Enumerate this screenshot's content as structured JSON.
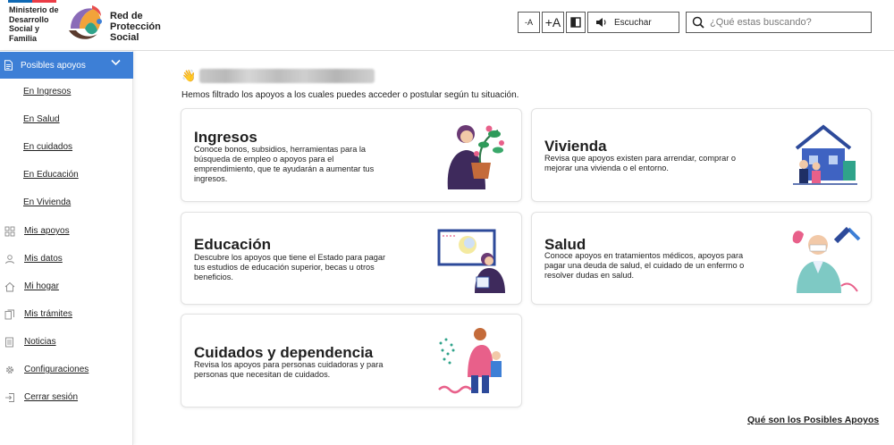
{
  "header": {
    "ministry_lines": [
      "Ministerio de",
      "Desarrollo",
      "Social y",
      "Familia"
    ],
    "network_lines": [
      "Red de",
      "Protección",
      "Social"
    ],
    "accessibility": {
      "decrease_text": "-A",
      "increase_text": "+A",
      "contrast_icon": "contrast-icon",
      "listen_label": "Escuchar"
    },
    "search": {
      "placeholder": "¿Qué estas buscando?",
      "value": ""
    }
  },
  "sidebar": {
    "active": {
      "label": "Posibles apoyos",
      "icon": "document-icon"
    },
    "sub_items": [
      "En Ingresos",
      "En Salud",
      "En cuidados",
      "En Educación",
      "En Vivienda"
    ],
    "items": [
      {
        "label": "Mis apoyos",
        "icon": "grid-icon"
      },
      {
        "label": "Mis datos",
        "icon": "user-icon"
      },
      {
        "label": "Mi hogar",
        "icon": "home-icon"
      },
      {
        "label": "Mis trámites",
        "icon": "files-icon"
      },
      {
        "label": "Noticias",
        "icon": "news-icon"
      },
      {
        "label": "Configuraciones",
        "icon": "gear-icon"
      },
      {
        "label": "Cerrar sesión",
        "icon": "logout-icon"
      }
    ]
  },
  "main": {
    "greeting_emoji": "👋",
    "intro": "Hemos filtrado los apoyos a los cuales puedes acceder o postular según tu situación.",
    "cards": {
      "ingresos": {
        "title": "Ingresos",
        "description": "Conoce bonos, subsidios, herramientas para la búsqueda de empleo o apoyos para el emprendimiento, que te ayudarán a aumentar tus ingresos."
      },
      "vivienda": {
        "title": "Vivienda",
        "description": "Revisa que apoyos existen para arrendar, comprar o mejorar una vivienda o el entorno."
      },
      "educacion": {
        "title": "Educación",
        "description": "Descubre los apoyos que tiene el Estado para pagar tus estudios de educación superior, becas u otros beneficios."
      },
      "salud": {
        "title": "Salud",
        "description": "Conoce apoyos en tratamientos médicos, apoyos para pagar una deuda de salud, el cuidado de un enfermo o resolver dudas en salud."
      },
      "cuidados": {
        "title": "Cuidados y dependencia",
        "description": "Revisa los apoyos para personas cuidadoras y para personas que necesitan de cuidados."
      }
    },
    "footer_link": "Qué son los Posibles Apoyos"
  },
  "colors": {
    "accent": "#3d7fd6",
    "flag_blue": "#0f69b4",
    "flag_red": "#eb3c46"
  }
}
